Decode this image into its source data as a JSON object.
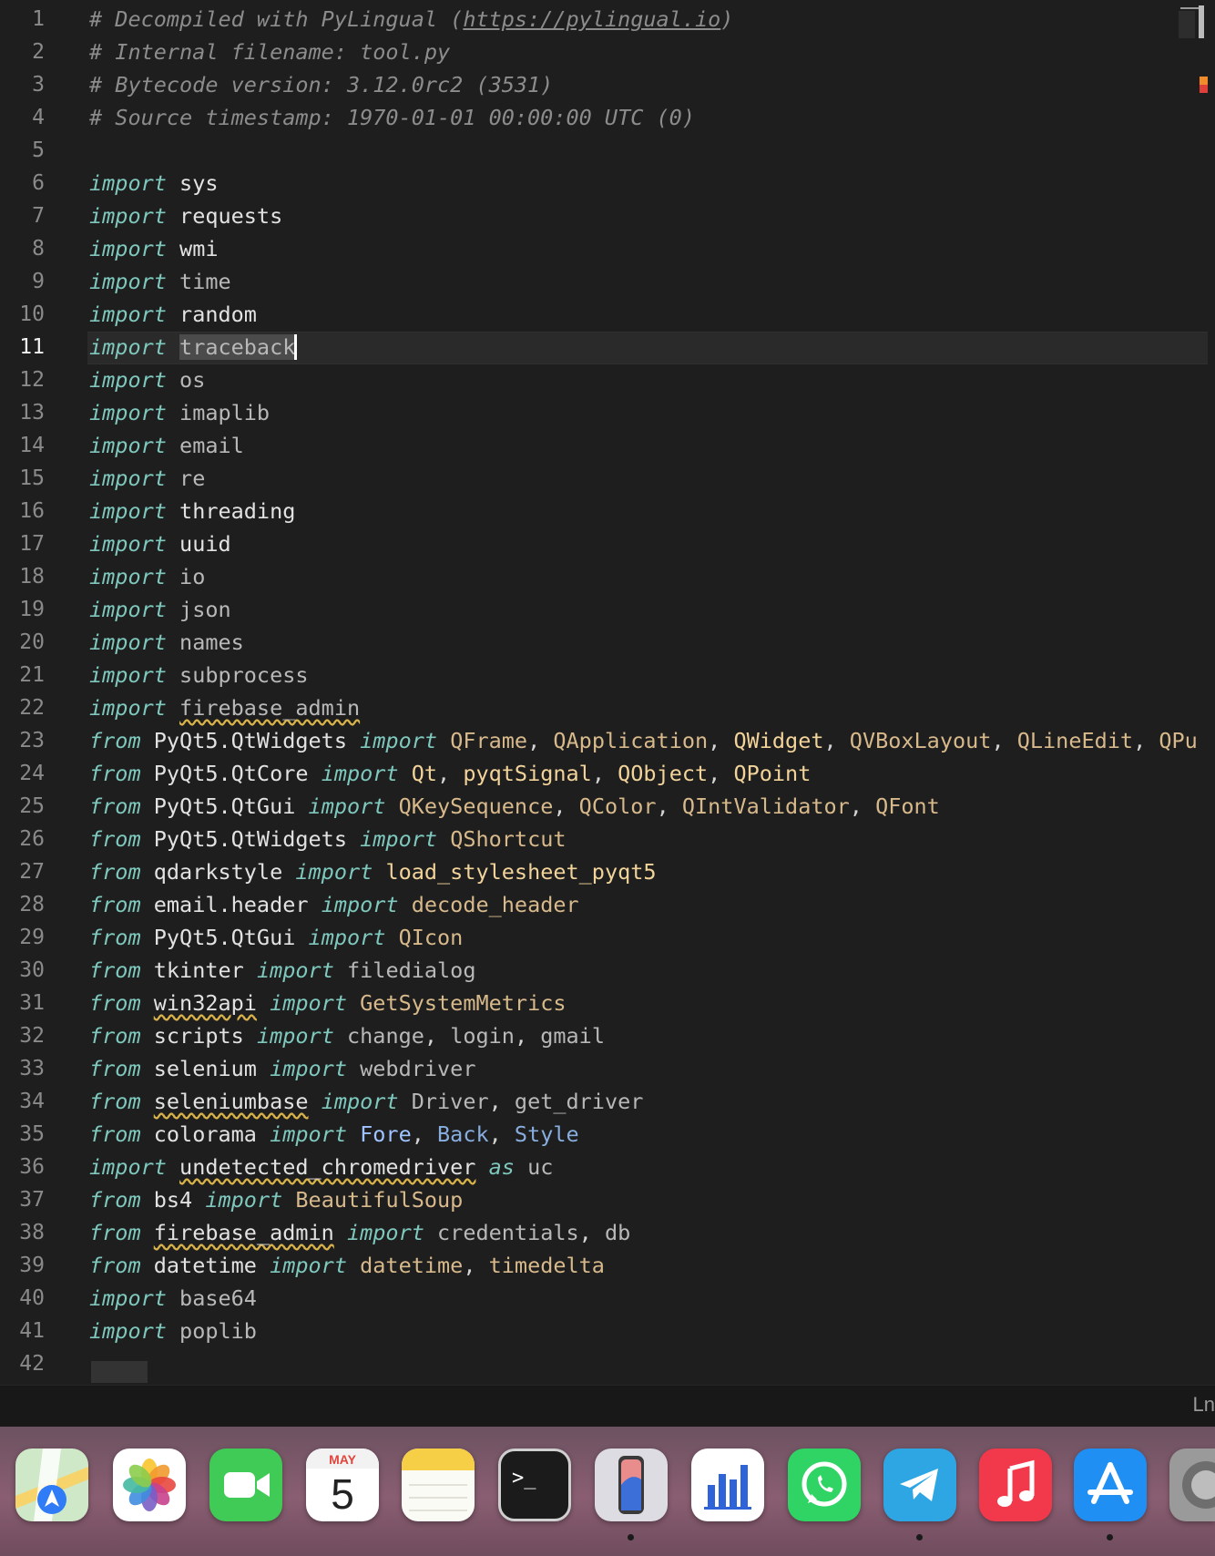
{
  "editor": {
    "active_line": 11,
    "lines": [
      {
        "n": "1",
        "tokens": [
          {
            "t": "# Decompiled with PyLingual (",
            "c": "cmt"
          },
          {
            "t": "https://pylingual.io",
            "c": "cmt und"
          },
          {
            "t": ")",
            "c": "cmt"
          }
        ]
      },
      {
        "n": "2",
        "tokens": [
          {
            "t": "# Internal filename: tool.py",
            "c": "cmt"
          }
        ]
      },
      {
        "n": "3",
        "tokens": [
          {
            "t": "# Bytecode version: 3.12.0rc2 (3531)",
            "c": "cmt"
          }
        ]
      },
      {
        "n": "4",
        "tokens": [
          {
            "t": "# Source timestamp: 1970-01-01 00:00:00 UTC (0)",
            "c": "cmt"
          }
        ]
      },
      {
        "n": "5",
        "tokens": []
      },
      {
        "n": "6",
        "tokens": [
          {
            "t": "import",
            "c": "kw"
          },
          {
            "t": " "
          },
          {
            "t": "sys",
            "c": "mod"
          }
        ]
      },
      {
        "n": "7",
        "tokens": [
          {
            "t": "import",
            "c": "kw"
          },
          {
            "t": " "
          },
          {
            "t": "requests",
            "c": "mod"
          }
        ]
      },
      {
        "n": "8",
        "tokens": [
          {
            "t": "import",
            "c": "kw"
          },
          {
            "t": " "
          },
          {
            "t": "wmi",
            "c": "mod"
          }
        ]
      },
      {
        "n": "9",
        "tokens": [
          {
            "t": "import",
            "c": "kw"
          },
          {
            "t": " "
          },
          {
            "t": "time",
            "c": "dim"
          }
        ]
      },
      {
        "n": "10",
        "tokens": [
          {
            "t": "import",
            "c": "kw"
          },
          {
            "t": " "
          },
          {
            "t": "random",
            "c": "mod"
          }
        ]
      },
      {
        "n": "11",
        "tokens": [
          {
            "t": "import",
            "c": "kw"
          },
          {
            "t": " "
          },
          {
            "t": "traceback",
            "c": "dim sel"
          }
        ]
      },
      {
        "n": "12",
        "tokens": [
          {
            "t": "import",
            "c": "kw"
          },
          {
            "t": " "
          },
          {
            "t": "os",
            "c": "dim"
          }
        ]
      },
      {
        "n": "13",
        "tokens": [
          {
            "t": "import",
            "c": "kw"
          },
          {
            "t": " "
          },
          {
            "t": "imaplib",
            "c": "dim"
          }
        ]
      },
      {
        "n": "14",
        "tokens": [
          {
            "t": "import",
            "c": "kw"
          },
          {
            "t": " "
          },
          {
            "t": "email",
            "c": "dim"
          }
        ]
      },
      {
        "n": "15",
        "tokens": [
          {
            "t": "import",
            "c": "kw"
          },
          {
            "t": " "
          },
          {
            "t": "re",
            "c": "dim"
          }
        ]
      },
      {
        "n": "16",
        "tokens": [
          {
            "t": "import",
            "c": "kw"
          },
          {
            "t": " "
          },
          {
            "t": "threading",
            "c": "mod"
          }
        ]
      },
      {
        "n": "17",
        "tokens": [
          {
            "t": "import",
            "c": "kw"
          },
          {
            "t": " "
          },
          {
            "t": "uuid",
            "c": "mod"
          }
        ]
      },
      {
        "n": "18",
        "tokens": [
          {
            "t": "import",
            "c": "kw"
          },
          {
            "t": " "
          },
          {
            "t": "io",
            "c": "dim"
          }
        ]
      },
      {
        "n": "19",
        "tokens": [
          {
            "t": "import",
            "c": "kw"
          },
          {
            "t": " "
          },
          {
            "t": "json",
            "c": "dim"
          }
        ]
      },
      {
        "n": "20",
        "tokens": [
          {
            "t": "import",
            "c": "kw"
          },
          {
            "t": " "
          },
          {
            "t": "names",
            "c": "dim"
          }
        ]
      },
      {
        "n": "21",
        "tokens": [
          {
            "t": "import",
            "c": "kw"
          },
          {
            "t": " "
          },
          {
            "t": "subprocess",
            "c": "dim"
          }
        ]
      },
      {
        "n": "22",
        "tokens": [
          {
            "t": "import",
            "c": "kw"
          },
          {
            "t": " "
          },
          {
            "t": "firebase_admin",
            "c": "dim sq"
          }
        ]
      },
      {
        "n": "23",
        "tokens": [
          {
            "t": "from",
            "c": "kw"
          },
          {
            "t": " "
          },
          {
            "t": "PyQt5.QtWidgets",
            "c": "mod"
          },
          {
            "t": " "
          },
          {
            "t": "import",
            "c": "kw"
          },
          {
            "t": " "
          },
          {
            "t": "QFrame",
            "c": "ty"
          },
          {
            "t": ", ",
            "c": "pl"
          },
          {
            "t": "QApplication",
            "c": "ty"
          },
          {
            "t": ", ",
            "c": "pl"
          },
          {
            "t": "QWidget",
            "c": "fn"
          },
          {
            "t": ", ",
            "c": "pl"
          },
          {
            "t": "QVBoxLayout",
            "c": "ty"
          },
          {
            "t": ", ",
            "c": "pl"
          },
          {
            "t": "QLineEdit",
            "c": "ty"
          },
          {
            "t": ", ",
            "c": "pl"
          },
          {
            "t": "QPu",
            "c": "ty"
          }
        ]
      },
      {
        "n": "24",
        "tokens": [
          {
            "t": "from",
            "c": "kw"
          },
          {
            "t": " "
          },
          {
            "t": "PyQt5.QtCore",
            "c": "mod"
          },
          {
            "t": " "
          },
          {
            "t": "import",
            "c": "kw"
          },
          {
            "t": " "
          },
          {
            "t": "Qt",
            "c": "fn"
          },
          {
            "t": ", ",
            "c": "pl"
          },
          {
            "t": "pyqtSignal",
            "c": "fn"
          },
          {
            "t": ", ",
            "c": "pl"
          },
          {
            "t": "QObject",
            "c": "fn"
          },
          {
            "t": ", ",
            "c": "pl"
          },
          {
            "t": "QPoint",
            "c": "fn"
          }
        ]
      },
      {
        "n": "25",
        "tokens": [
          {
            "t": "from",
            "c": "kw"
          },
          {
            "t": " "
          },
          {
            "t": "PyQt5.QtGui",
            "c": "mod"
          },
          {
            "t": " "
          },
          {
            "t": "import",
            "c": "kw"
          },
          {
            "t": " "
          },
          {
            "t": "QKeySequence",
            "c": "ty"
          },
          {
            "t": ", ",
            "c": "pl"
          },
          {
            "t": "QColor",
            "c": "ty"
          },
          {
            "t": ", ",
            "c": "pl"
          },
          {
            "t": "QIntValidator",
            "c": "ty"
          },
          {
            "t": ", ",
            "c": "pl"
          },
          {
            "t": "QFont",
            "c": "ty"
          }
        ]
      },
      {
        "n": "26",
        "tokens": [
          {
            "t": "from",
            "c": "kw"
          },
          {
            "t": " "
          },
          {
            "t": "PyQt5.QtWidgets",
            "c": "mod"
          },
          {
            "t": " "
          },
          {
            "t": "import",
            "c": "kw"
          },
          {
            "t": " "
          },
          {
            "t": "QShortcut",
            "c": "ty"
          }
        ]
      },
      {
        "n": "27",
        "tokens": [
          {
            "t": "from",
            "c": "kw"
          },
          {
            "t": " "
          },
          {
            "t": "qdarkstyle",
            "c": "mod"
          },
          {
            "t": " "
          },
          {
            "t": "import",
            "c": "kw"
          },
          {
            "t": " "
          },
          {
            "t": "load_stylesheet_pyqt5",
            "c": "fn"
          }
        ]
      },
      {
        "n": "28",
        "tokens": [
          {
            "t": "from",
            "c": "kw"
          },
          {
            "t": " "
          },
          {
            "t": "email.header",
            "c": "mod"
          },
          {
            "t": " "
          },
          {
            "t": "import",
            "c": "kw"
          },
          {
            "t": " "
          },
          {
            "t": "decode_header",
            "c": "ty"
          }
        ]
      },
      {
        "n": "29",
        "tokens": [
          {
            "t": "from",
            "c": "kw"
          },
          {
            "t": " "
          },
          {
            "t": "PyQt5.QtGui",
            "c": "mod"
          },
          {
            "t": " "
          },
          {
            "t": "import",
            "c": "kw"
          },
          {
            "t": " "
          },
          {
            "t": "QIcon",
            "c": "ty"
          }
        ]
      },
      {
        "n": "30",
        "tokens": [
          {
            "t": "from",
            "c": "kw"
          },
          {
            "t": " "
          },
          {
            "t": "tkinter",
            "c": "mod"
          },
          {
            "t": " "
          },
          {
            "t": "import",
            "c": "kw"
          },
          {
            "t": " "
          },
          {
            "t": "filedialog",
            "c": "dim"
          }
        ]
      },
      {
        "n": "31",
        "tokens": [
          {
            "t": "from",
            "c": "kw"
          },
          {
            "t": " "
          },
          {
            "t": "win32api",
            "c": "mod sq"
          },
          {
            "t": " "
          },
          {
            "t": "import",
            "c": "kw"
          },
          {
            "t": " "
          },
          {
            "t": "GetSystemMetrics",
            "c": "ty"
          }
        ]
      },
      {
        "n": "32",
        "tokens": [
          {
            "t": "from",
            "c": "kw"
          },
          {
            "t": " "
          },
          {
            "t": "scripts",
            "c": "mod"
          },
          {
            "t": " "
          },
          {
            "t": "import",
            "c": "kw"
          },
          {
            "t": " "
          },
          {
            "t": "change",
            "c": "dim"
          },
          {
            "t": ", ",
            "c": "pl"
          },
          {
            "t": "login",
            "c": "dim"
          },
          {
            "t": ", ",
            "c": "pl"
          },
          {
            "t": "gmail",
            "c": "dim"
          }
        ]
      },
      {
        "n": "33",
        "tokens": [
          {
            "t": "from",
            "c": "kw"
          },
          {
            "t": " "
          },
          {
            "t": "selenium",
            "c": "mod"
          },
          {
            "t": " "
          },
          {
            "t": "import",
            "c": "kw"
          },
          {
            "t": " "
          },
          {
            "t": "webdriver",
            "c": "dim"
          }
        ]
      },
      {
        "n": "34",
        "tokens": [
          {
            "t": "from",
            "c": "kw"
          },
          {
            "t": " "
          },
          {
            "t": "seleniumbase",
            "c": "mod sq"
          },
          {
            "t": " "
          },
          {
            "t": "import",
            "c": "kw"
          },
          {
            "t": " "
          },
          {
            "t": "Driver",
            "c": "dim"
          },
          {
            "t": ", ",
            "c": "pl"
          },
          {
            "t": "get_driver",
            "c": "dim"
          }
        ]
      },
      {
        "n": "35",
        "tokens": [
          {
            "t": "from",
            "c": "kw"
          },
          {
            "t": " "
          },
          {
            "t": "colorama",
            "c": "mod"
          },
          {
            "t": " "
          },
          {
            "t": "import",
            "c": "kw"
          },
          {
            "t": " "
          },
          {
            "t": "Fore",
            "c": "bl"
          },
          {
            "t": ", ",
            "c": "pl"
          },
          {
            "t": "Back",
            "c": "bl2"
          },
          {
            "t": ", ",
            "c": "pl"
          },
          {
            "t": "Style",
            "c": "bl2"
          }
        ]
      },
      {
        "n": "36",
        "tokens": [
          {
            "t": "import",
            "c": "kw"
          },
          {
            "t": " "
          },
          {
            "t": "undetected_chromedriver",
            "c": "mod sq"
          },
          {
            "t": " "
          },
          {
            "t": "as",
            "c": "kw"
          },
          {
            "t": " "
          },
          {
            "t": "uc",
            "c": "dim"
          }
        ]
      },
      {
        "n": "37",
        "tokens": [
          {
            "t": "from",
            "c": "kw"
          },
          {
            "t": " "
          },
          {
            "t": "bs4",
            "c": "mod"
          },
          {
            "t": " "
          },
          {
            "t": "import",
            "c": "kw"
          },
          {
            "t": " "
          },
          {
            "t": "BeautifulSoup",
            "c": "ty"
          }
        ]
      },
      {
        "n": "38",
        "tokens": [
          {
            "t": "from",
            "c": "kw"
          },
          {
            "t": " "
          },
          {
            "t": "firebase_admin",
            "c": "mod sq"
          },
          {
            "t": " "
          },
          {
            "t": "import",
            "c": "kw"
          },
          {
            "t": " "
          },
          {
            "t": "credentials",
            "c": "dim"
          },
          {
            "t": ", ",
            "c": "pl"
          },
          {
            "t": "db",
            "c": "dim"
          }
        ]
      },
      {
        "n": "39",
        "tokens": [
          {
            "t": "from",
            "c": "kw"
          },
          {
            "t": " "
          },
          {
            "t": "datetime",
            "c": "mod"
          },
          {
            "t": " "
          },
          {
            "t": "import",
            "c": "kw"
          },
          {
            "t": " "
          },
          {
            "t": "datetime",
            "c": "ty"
          },
          {
            "t": ", ",
            "c": "pl"
          },
          {
            "t": "timedelta",
            "c": "ty"
          }
        ]
      },
      {
        "n": "40",
        "tokens": [
          {
            "t": "import",
            "c": "kw"
          },
          {
            "t": " "
          },
          {
            "t": "base64",
            "c": "dim"
          }
        ]
      },
      {
        "n": "41",
        "tokens": [
          {
            "t": "import",
            "c": "kw"
          },
          {
            "t": " "
          },
          {
            "t": "poplib",
            "c": "dim"
          }
        ]
      },
      {
        "n": "42",
        "tokens": []
      }
    ]
  },
  "status_bar": {
    "position_text": "Ln"
  },
  "dock": {
    "apps": [
      {
        "name": "maps-icon",
        "label": "Maps",
        "running": false
      },
      {
        "name": "photos-icon",
        "label": "Photos",
        "running": false
      },
      {
        "name": "facetime-icon",
        "label": "FaceTime",
        "running": false
      },
      {
        "name": "calendar-icon",
        "label": "Calendar",
        "month": "MAY",
        "day": "5",
        "running": false
      },
      {
        "name": "notes-icon",
        "label": "Notes",
        "running": false
      },
      {
        "name": "terminal-icon",
        "label": "Terminal",
        "running": false
      },
      {
        "name": "iphone-mirroring-icon",
        "label": "iPhone Mirroring",
        "running": true
      },
      {
        "name": "keynote-icon",
        "label": "Keynote",
        "running": false
      },
      {
        "name": "whatsapp-icon",
        "label": "WhatsApp",
        "running": false
      },
      {
        "name": "telegram-icon",
        "label": "Telegram",
        "running": true
      },
      {
        "name": "music-icon",
        "label": "Music",
        "running": false
      },
      {
        "name": "app-store-icon",
        "label": "App Store",
        "running": true
      },
      {
        "name": "system-settings-icon",
        "label": "System Settings",
        "running": false
      }
    ]
  },
  "colors": {
    "background": "#1e1e1e",
    "keyword": "#7ec8bd",
    "comment": "#8c8c8c",
    "type": "#d7b98b",
    "function": "#f2d49a",
    "squiggle": "#d9b34a"
  }
}
